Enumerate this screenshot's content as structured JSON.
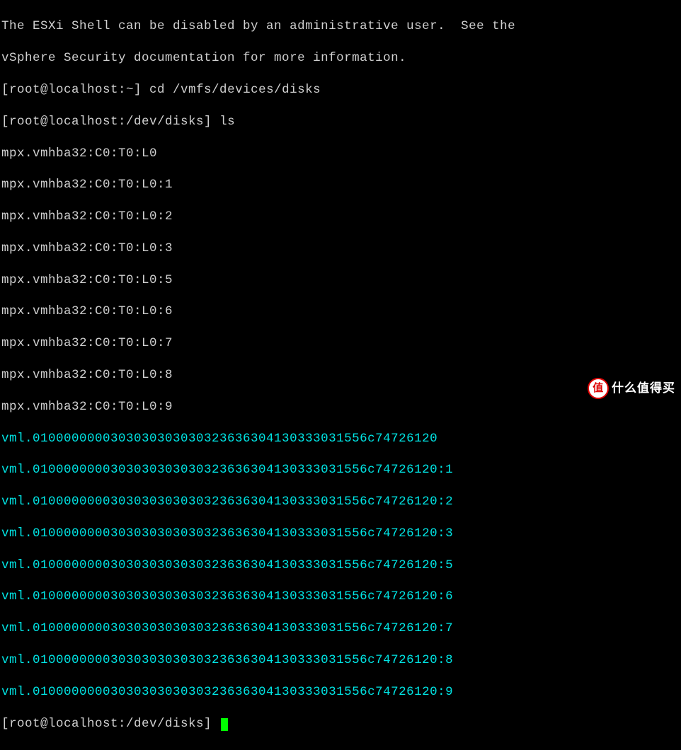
{
  "motd": {
    "line1": "The ESXi Shell can be disabled by an administrative user.  See the",
    "line2": "vSphere Security documentation for more information."
  },
  "history": [
    {
      "prompt": "[root@localhost:~] ",
      "command": "cd /vmfs/devices/disks"
    },
    {
      "prompt": "[root@localhost:/dev/disks] ",
      "command": "ls"
    }
  ],
  "ls_output": {
    "white_entries": [
      "mpx.vmhba32:C0:T0:L0",
      "mpx.vmhba32:C0:T0:L0:1",
      "mpx.vmhba32:C0:T0:L0:2",
      "mpx.vmhba32:C0:T0:L0:3",
      "mpx.vmhba32:C0:T0:L0:5",
      "mpx.vmhba32:C0:T0:L0:6",
      "mpx.vmhba32:C0:T0:L0:7",
      "mpx.vmhba32:C0:T0:L0:8",
      "mpx.vmhba32:C0:T0:L0:9"
    ],
    "cyan_entries": [
      "vml.0100000000303030303030323636304130333031556c74726120",
      "vml.0100000000303030303030323636304130333031556c74726120:1",
      "vml.0100000000303030303030323636304130333031556c74726120:2",
      "vml.0100000000303030303030323636304130333031556c74726120:3",
      "vml.0100000000303030303030323636304130333031556c74726120:5",
      "vml.0100000000303030303030323636304130333031556c74726120:6",
      "vml.0100000000303030303030323636304130333031556c74726120:7",
      "vml.0100000000303030303030323636304130333031556c74726120:8",
      "vml.0100000000303030303030323636304130333031556c74726120:9"
    ]
  },
  "current_prompt": "[root@localhost:/dev/disks] ",
  "watermark": {
    "icon_text": "值",
    "text": "什么值得买"
  }
}
